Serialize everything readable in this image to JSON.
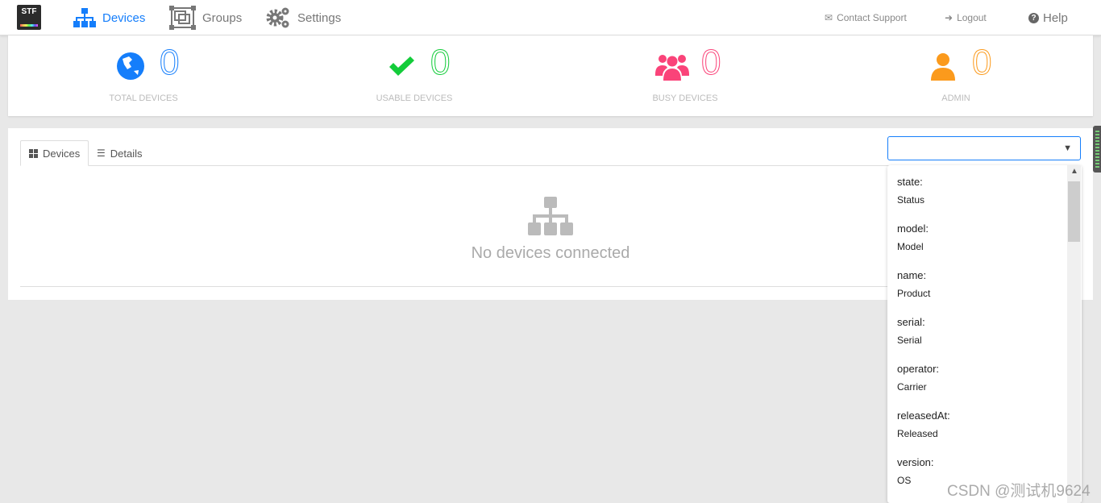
{
  "nav": {
    "logo": "STF",
    "items": [
      {
        "label": "Devices",
        "icon": "sitemap-icon",
        "active": true
      },
      {
        "label": "Groups",
        "icon": "groups-icon"
      },
      {
        "label": "Settings",
        "icon": "gears-icon"
      }
    ],
    "contact": "Contact Support",
    "logout": "Logout",
    "help": "Help"
  },
  "stats": [
    {
      "value": "0",
      "label": "TOTAL DEVICES",
      "color": "#157efb",
      "icon": "globe-icon"
    },
    {
      "value": "0",
      "label": "USABLE DEVICES",
      "color": "#13cc3a",
      "icon": "check-icon"
    },
    {
      "value": "0",
      "label": "BUSY DEVICES",
      "color": "#fa4379",
      "icon": "users-icon"
    },
    {
      "value": "0",
      "label": "ADMIN",
      "color": "#fb9a1c",
      "icon": "user-icon"
    }
  ],
  "tabs": [
    {
      "label": "Devices",
      "active": true
    },
    {
      "label": "Details"
    }
  ],
  "empty": "No devices connected",
  "select": {
    "value": ""
  },
  "options": [
    {
      "key": "state:",
      "label": "Status"
    },
    {
      "key": "model:",
      "label": "Model"
    },
    {
      "key": "name:",
      "label": "Product"
    },
    {
      "key": "serial:",
      "label": "Serial"
    },
    {
      "key": "operator:",
      "label": "Carrier"
    },
    {
      "key": "releasedAt:",
      "label": "Released"
    },
    {
      "key": "version:",
      "label": "OS"
    }
  ],
  "watermark": "CSDN @测试机9624"
}
